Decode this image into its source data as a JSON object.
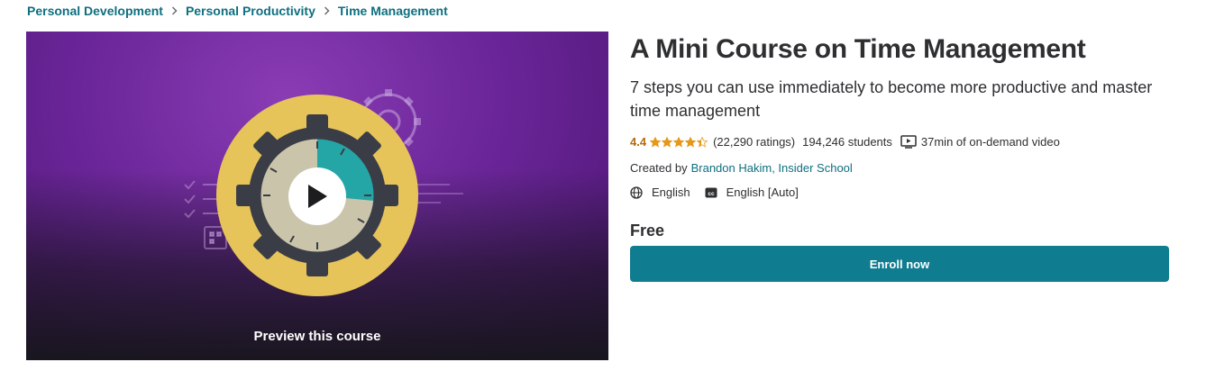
{
  "breadcrumb": {
    "items": [
      "Personal Development",
      "Personal Productivity",
      "Time Management"
    ],
    "separator_icon": "chevron-right-icon"
  },
  "preview": {
    "label": "Preview this course",
    "play_icon": "play-icon",
    "colors": {
      "purple": "#6b2699",
      "gear_yellow": "#e6c45a",
      "gear_dark": "#3a3d46",
      "teal": "#25a6a6"
    }
  },
  "course": {
    "title": "A Mini Course on Time Management",
    "subtitle": "7 steps you can use immediately to become more productive and master time management",
    "rating": "4.4",
    "stars_value": 4.4,
    "stars_max": 5,
    "ratings_count": "(22,290 ratings)",
    "students": "194,246 students",
    "video_length": "37min of on-demand video",
    "created_by_label": "Created by",
    "instructors": "Brandon Hakim, Insider School",
    "language": "English",
    "captions": "English [Auto]",
    "price": "Free",
    "enroll_label": "Enroll now"
  },
  "colors": {
    "link_teal": "#0e6f7f",
    "rating_orange": "#b4690e",
    "star_color": "#e59819",
    "button_teal": "#0f7c90"
  }
}
